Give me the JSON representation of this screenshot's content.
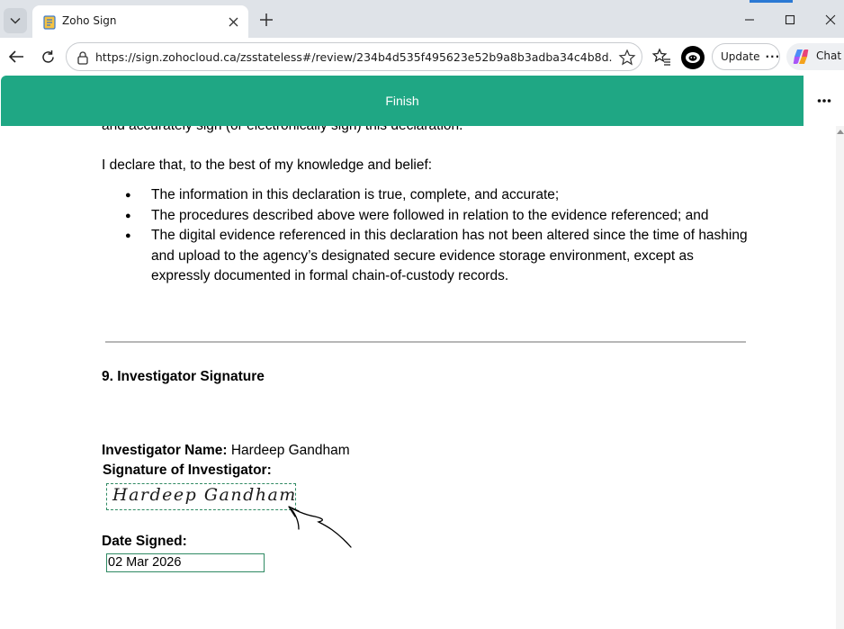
{
  "browser": {
    "tab_title": "Zoho Sign",
    "url": "https://sign.zohocloud.ca/zsstateless#/review/234b4d535f495623e52b9a8b3adba34c4b8d...",
    "update_label": "Update",
    "copilot_label": "Chat"
  },
  "app": {
    "finish_label": "Finish",
    "more_label": "•••"
  },
  "document": {
    "cutoff_line": "and accurately sign (or electronically sign) this declaration.",
    "declaration_intro": "I declare that, to the best of my knowledge and belief:",
    "bullets": [
      "The information in this declaration is true, complete, and accurate;",
      "The procedures described above were followed in relation to the evidence referenced; and",
      "The digital evidence referenced in this declaration has not been altered since the time of hashing and upload to the agency’s designated secure evidence storage environment, except as expressly documented in formal chain-of-custody records."
    ],
    "section_title": "9. Investigator Signature",
    "investigator_name_label": "Investigator Name:",
    "investigator_name": "Hardeep Gandham",
    "signature_label": "Signature of Investigator:",
    "signature_text": "Hardeep Gandham",
    "date_label": "Date Signed:",
    "date_value": "02 Mar 2026"
  }
}
